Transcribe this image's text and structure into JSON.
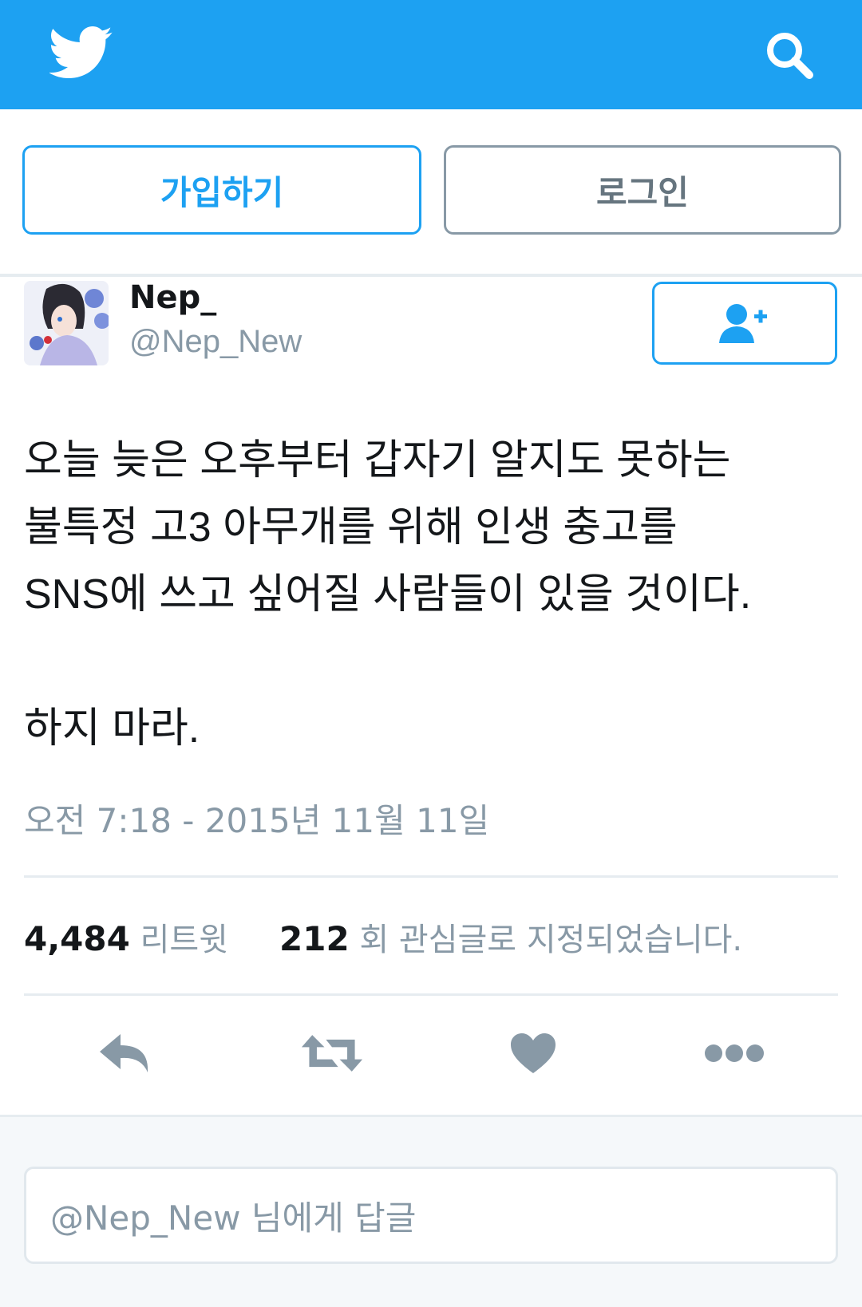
{
  "header": {
    "logo_icon": "twitter-bird-icon",
    "search_icon": "search-icon",
    "background": "#1da1f2"
  },
  "auth": {
    "signup_label": "가입하기",
    "login_label": "로그인"
  },
  "tweet": {
    "display_name": "Nep_",
    "handle": "@Nep_New",
    "follow_icon": "add-user-icon",
    "text": "오늘 늦은 오후부터 갑자기 알지도 못하는\n불특정 고3 아무개를 위해 인생 충고를\nSNS에 쓰고 싶어질 사람들이 있을 것이다.\n\n하지 마라.",
    "timestamp": "오전 7:18 - 2015년 11월 11일"
  },
  "stats": {
    "retweets_count": "4,484",
    "retweets_label": "리트윗",
    "likes_count": "212",
    "likes_label": "회 관심글로 지정되었습니다."
  },
  "actions": [
    "reply-icon",
    "retweet-icon",
    "heart-icon",
    "more-icon"
  ],
  "reply": {
    "placeholder": "@Nep_New 님에게 답글"
  }
}
